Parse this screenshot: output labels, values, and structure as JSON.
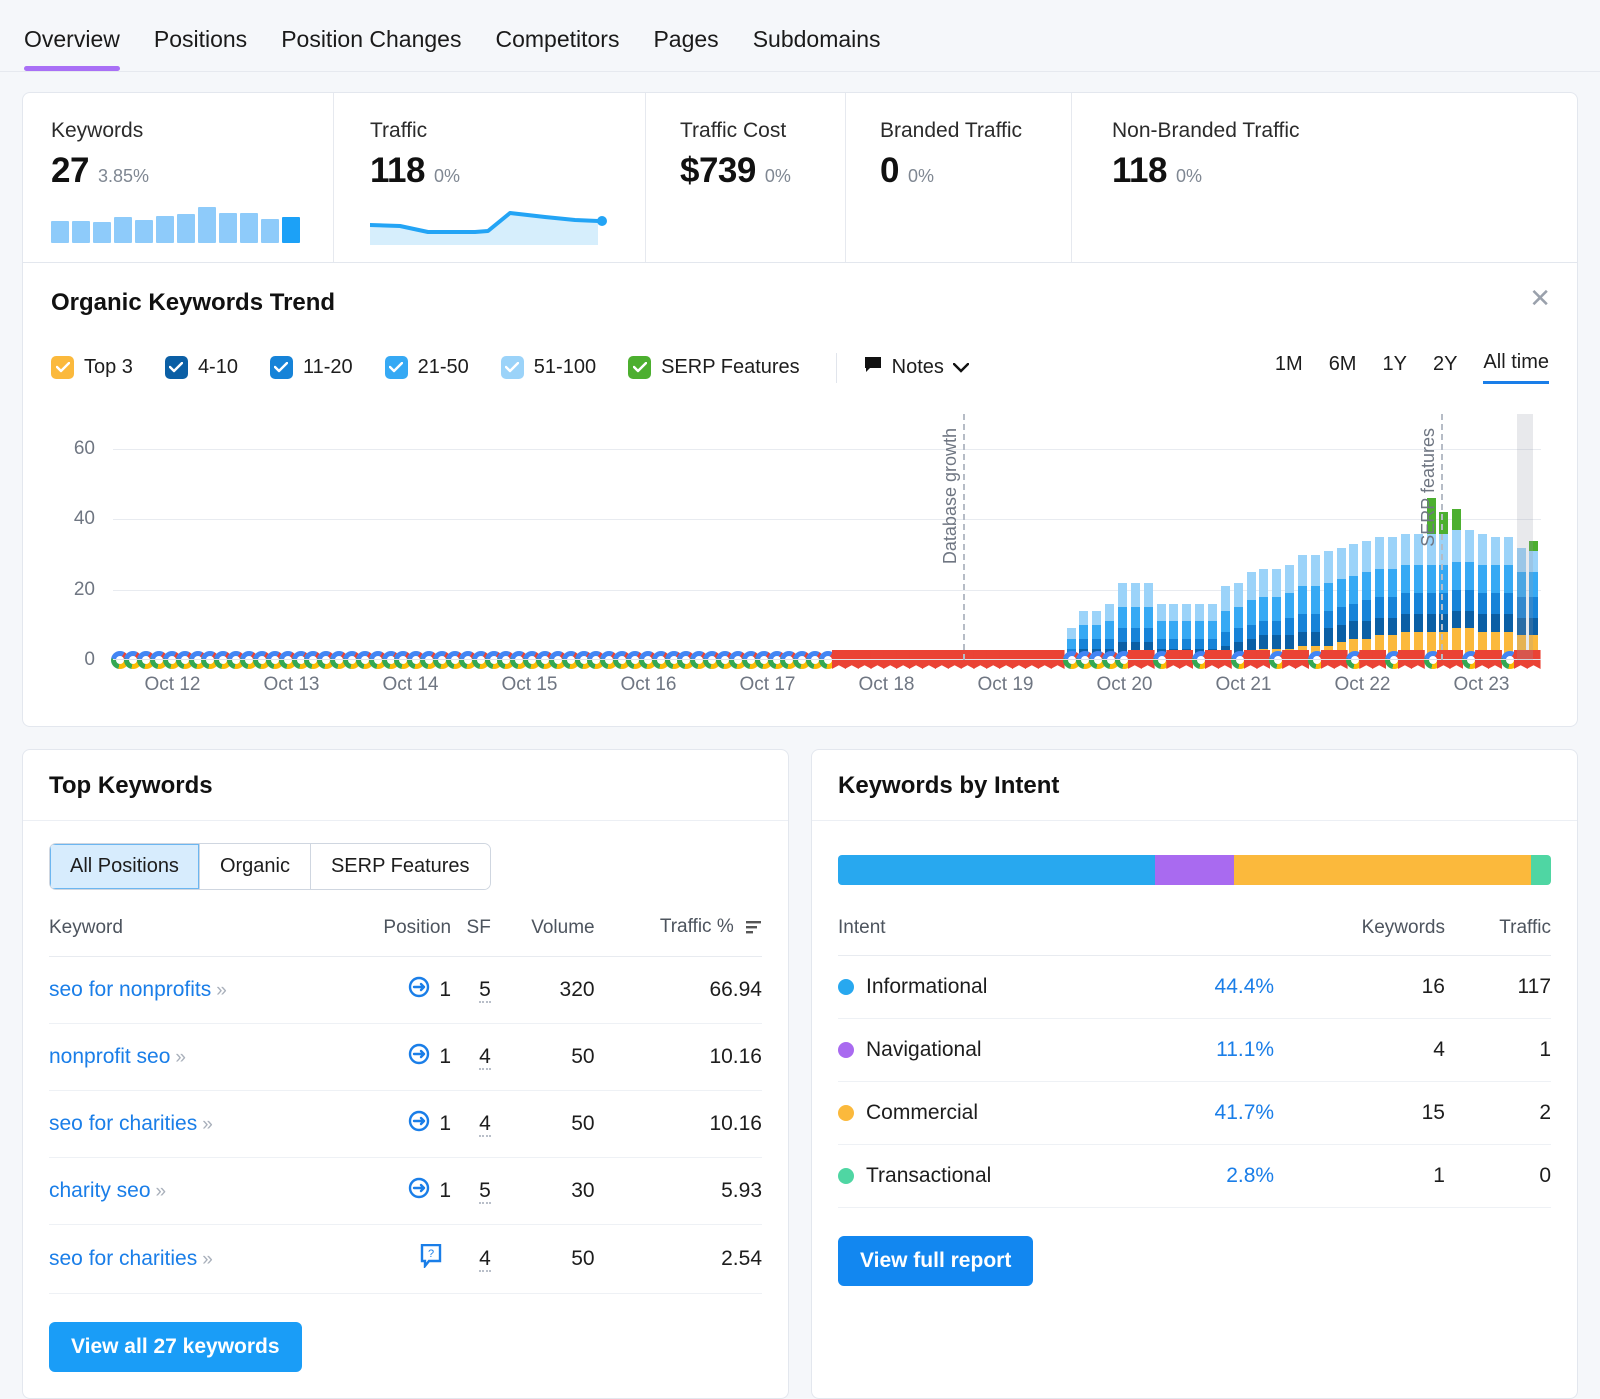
{
  "tabs": [
    {
      "label": "Overview",
      "active": true
    },
    {
      "label": "Positions",
      "active": false
    },
    {
      "label": "Position Changes",
      "active": false
    },
    {
      "label": "Competitors",
      "active": false
    },
    {
      "label": "Pages",
      "active": false
    },
    {
      "label": "Subdomains",
      "active": false
    }
  ],
  "metrics": [
    {
      "label": "Keywords",
      "value": "27",
      "delta": "3.85%"
    },
    {
      "label": "Traffic",
      "value": "118",
      "delta": "0%"
    },
    {
      "label": "Traffic Cost",
      "value": "$739",
      "delta": "0%"
    },
    {
      "label": "Branded Traffic",
      "value": "0",
      "delta": "0%"
    },
    {
      "label": "Non-Branded Traffic",
      "value": "118",
      "delta": "0%"
    }
  ],
  "keywords_sparkline": [
    22,
    22,
    21,
    26,
    23,
    27,
    29,
    36,
    30,
    30,
    24,
    26
  ],
  "trend": {
    "title": "Organic Keywords Trend",
    "close_label": "✕",
    "legend": [
      {
        "label": "Top 3",
        "color": "#fbb93c",
        "checked": true
      },
      {
        "label": "4-10",
        "color": "#0b5fa5",
        "checked": true
      },
      {
        "label": "11-20",
        "color": "#1683d8",
        "checked": true
      },
      {
        "label": "21-50",
        "color": "#36a9f4",
        "checked": true
      },
      {
        "label": "51-100",
        "color": "#9bd3f9",
        "checked": true
      },
      {
        "label": "SERP Features",
        "color": "#4caf2f",
        "checked": true
      }
    ],
    "notes_label": "Notes",
    "ranges": [
      {
        "label": "1M",
        "active": false
      },
      {
        "label": "6M",
        "active": false
      },
      {
        "label": "1Y",
        "active": false
      },
      {
        "label": "2Y",
        "active": false
      },
      {
        "label": "All time",
        "active": true
      }
    ]
  },
  "chart_data": {
    "type": "bar",
    "title": "Organic Keywords Trend",
    "xlabel": "",
    "ylabel": "",
    "ylim": [
      0,
      70
    ],
    "yticks": [
      0,
      20,
      40,
      60
    ],
    "grid": true,
    "legend_position": "top-left",
    "stacked": true,
    "x_tick_labels": [
      "Oct 12",
      "Oct 13",
      "Oct 14",
      "Oct 15",
      "Oct 16",
      "Oct 17",
      "Oct 18",
      "Oct 19",
      "Oct 20",
      "Oct 21",
      "Oct 22",
      "Oct 23"
    ],
    "annotations": [
      {
        "label": "Database growth",
        "x_position_pct": 59.5
      },
      {
        "label": "SERP features",
        "x_position_pct": 93.0
      }
    ],
    "series": [
      {
        "name": "Top 3",
        "color": "#fbb93c",
        "values": [
          0,
          0,
          0,
          0,
          0,
          0,
          0,
          0,
          0,
          0,
          0,
          0,
          0,
          0,
          0,
          0,
          0,
          0,
          0,
          0,
          0,
          0,
          0,
          0,
          0,
          0,
          0,
          0,
          0,
          0,
          0,
          0,
          0,
          0,
          0,
          0,
          0,
          0,
          0,
          0,
          0,
          0,
          0,
          0,
          0,
          0,
          0,
          0,
          0,
          0,
          0,
          0,
          0,
          0,
          0,
          0,
          0,
          0,
          0,
          0,
          0,
          0,
          0,
          0,
          0,
          0,
          0,
          0,
          0,
          0,
          0,
          0,
          0,
          0,
          0,
          1,
          1,
          1,
          2,
          2,
          2,
          1,
          1,
          1,
          1,
          1,
          1,
          2,
          2,
          3,
          3,
          3,
          4,
          4,
          4,
          5,
          6,
          6,
          7,
          7,
          8,
          8,
          8,
          8,
          9,
          9,
          8,
          8,
          8,
          7,
          7
        ]
      },
      {
        "name": "4-10",
        "color": "#0b5fa5",
        "values": [
          0,
          0,
          0,
          0,
          0,
          0,
          0,
          0,
          0,
          0,
          0,
          0,
          0,
          0,
          0,
          0,
          0,
          0,
          0,
          0,
          0,
          0,
          0,
          0,
          0,
          0,
          0,
          0,
          0,
          0,
          0,
          0,
          0,
          0,
          0,
          0,
          0,
          0,
          0,
          0,
          0,
          0,
          0,
          0,
          0,
          0,
          0,
          0,
          0,
          0,
          0,
          0,
          0,
          0,
          0,
          0,
          0,
          0,
          0,
          0,
          0,
          0,
          0,
          0,
          0,
          0,
          0,
          0,
          0,
          0,
          0,
          0,
          0,
          0,
          1,
          2,
          2,
          2,
          3,
          3,
          3,
          2,
          2,
          2,
          2,
          2,
          3,
          3,
          4,
          4,
          4,
          4,
          4,
          4,
          5,
          5,
          5,
          5,
          5,
          5,
          5,
          5,
          5,
          5,
          5,
          5,
          5,
          5,
          5,
          5,
          5
        ]
      },
      {
        "name": "11-20",
        "color": "#1683d8",
        "values": [
          0,
          0,
          0,
          0,
          0,
          0,
          0,
          0,
          0,
          0,
          0,
          0,
          0,
          0,
          0,
          0,
          0,
          0,
          0,
          0,
          0,
          0,
          0,
          0,
          0,
          0,
          0,
          0,
          0,
          0,
          0,
          0,
          0,
          0,
          0,
          0,
          0,
          0,
          0,
          0,
          0,
          0,
          0,
          0,
          0,
          0,
          0,
          0,
          0,
          0,
          0,
          0,
          0,
          0,
          0,
          0,
          0,
          0,
          0,
          0,
          0,
          0,
          0,
          0,
          0,
          0,
          0,
          0,
          0,
          0,
          0,
          0,
          0,
          0,
          2,
          3,
          3,
          3,
          4,
          4,
          4,
          3,
          3,
          3,
          3,
          3,
          4,
          4,
          4,
          4,
          4,
          5,
          5,
          5,
          5,
          5,
          5,
          6,
          6,
          6,
          6,
          6,
          6,
          6,
          6,
          6,
          6,
          6,
          6,
          6,
          6
        ]
      },
      {
        "name": "21-50",
        "color": "#36a9f4",
        "values": [
          0,
          0,
          0,
          0,
          0,
          0,
          0,
          0,
          0,
          0,
          0,
          0,
          0,
          0,
          0,
          0,
          0,
          0,
          0,
          0,
          0,
          0,
          0,
          0,
          0,
          0,
          0,
          0,
          0,
          0,
          0,
          0,
          0,
          0,
          0,
          0,
          0,
          0,
          0,
          0,
          0,
          0,
          0,
          0,
          0,
          0,
          0,
          0,
          0,
          0,
          0,
          0,
          0,
          0,
          0,
          0,
          0,
          0,
          0,
          0,
          0,
          0,
          0,
          0,
          0,
          0,
          0,
          0,
          0,
          0,
          0,
          0,
          0,
          0,
          3,
          4,
          4,
          5,
          6,
          6,
          6,
          5,
          5,
          5,
          5,
          5,
          6,
          6,
          7,
          7,
          7,
          7,
          8,
          8,
          8,
          8,
          8,
          8,
          8,
          8,
          8,
          8,
          8,
          8,
          8,
          8,
          8,
          8,
          8,
          7,
          7
        ]
      },
      {
        "name": "51-100",
        "color": "#9bd3f9",
        "values": [
          0,
          0,
          0,
          0,
          0,
          0,
          0,
          0,
          0,
          0,
          0,
          0,
          0,
          0,
          0,
          0,
          0,
          0,
          0,
          0,
          0,
          0,
          0,
          0,
          0,
          0,
          0,
          0,
          0,
          0,
          0,
          0,
          0,
          0,
          0,
          0,
          0,
          0,
          0,
          0,
          0,
          0,
          0,
          0,
          0,
          0,
          0,
          0,
          0,
          0,
          0,
          0,
          0,
          0,
          0,
          0,
          0,
          0,
          0,
          0,
          0,
          0,
          0,
          0,
          0,
          0,
          0,
          0,
          0,
          0,
          0,
          0,
          0,
          0,
          3,
          4,
          4,
          5,
          7,
          7,
          7,
          5,
          5,
          5,
          5,
          5,
          7,
          7,
          8,
          8,
          8,
          8,
          9,
          9,
          9,
          9,
          9,
          9,
          9,
          9,
          9,
          9,
          9,
          9,
          9,
          9,
          9,
          8,
          8,
          7,
          6
        ]
      },
      {
        "name": "SERP Features",
        "color": "#4caf2f",
        "values": [
          0,
          0,
          0,
          0,
          0,
          0,
          0,
          0,
          0,
          0,
          0,
          0,
          0,
          0,
          0,
          0,
          0,
          0,
          0,
          0,
          0,
          0,
          0,
          0,
          0,
          0,
          0,
          0,
          0,
          0,
          0,
          0,
          0,
          0,
          0,
          0,
          0,
          0,
          0,
          0,
          0,
          0,
          0,
          0,
          0,
          0,
          0,
          0,
          0,
          0,
          0,
          0,
          0,
          0,
          0,
          0,
          0,
          0,
          0,
          0,
          0,
          0,
          0,
          0,
          0,
          0,
          0,
          0,
          0,
          0,
          0,
          0,
          0,
          0,
          0,
          0,
          0,
          0,
          0,
          0,
          0,
          0,
          0,
          0,
          0,
          0,
          0,
          0,
          0,
          0,
          0,
          0,
          0,
          0,
          0,
          0,
          0,
          0,
          0,
          0,
          0,
          0,
          10,
          6,
          6,
          0,
          0,
          0,
          0,
          0,
          3
        ]
      }
    ]
  },
  "top_keywords": {
    "title": "Top Keywords",
    "tabs": [
      {
        "label": "All Positions",
        "active": true
      },
      {
        "label": "Organic",
        "active": false
      },
      {
        "label": "SERP Features",
        "active": false
      }
    ],
    "columns": [
      "Keyword",
      "Position",
      "SF",
      "Volume",
      "Traffic %"
    ],
    "rows": [
      {
        "keyword": "seo for nonprofits",
        "icon": "link-icon",
        "position": "1",
        "sf": "5",
        "volume": "320",
        "traffic_pct": "66.94"
      },
      {
        "keyword": "nonprofit seo",
        "icon": "link-icon",
        "position": "1",
        "sf": "4",
        "volume": "50",
        "traffic_pct": "10.16"
      },
      {
        "keyword": "seo for charities",
        "icon": "link-icon",
        "position": "1",
        "sf": "4",
        "volume": "50",
        "traffic_pct": "10.16"
      },
      {
        "keyword": "charity seo",
        "icon": "link-icon",
        "position": "1",
        "sf": "5",
        "volume": "30",
        "traffic_pct": "5.93"
      },
      {
        "keyword": "seo for charities",
        "icon": "faq-icon",
        "position": "",
        "sf": "4",
        "volume": "50",
        "traffic_pct": "2.54"
      }
    ],
    "view_all_label": "View all 27 keywords"
  },
  "keywords_by_intent": {
    "title": "Keywords by Intent",
    "bar": [
      {
        "name": "Informational",
        "pct": 44.4,
        "color": "#28a8ef"
      },
      {
        "name": "Navigational",
        "pct": 11.1,
        "color": "#a96af0"
      },
      {
        "name": "Commercial",
        "pct": 41.7,
        "color": "#fbb93c"
      },
      {
        "name": "Transactional",
        "pct": 2.8,
        "color": "#4fd6a3"
      }
    ],
    "columns": [
      "Intent",
      "",
      "Keywords",
      "Traffic"
    ],
    "rows": [
      {
        "intent": "Informational",
        "color": "#28a8ef",
        "pct": "44.4%",
        "keywords": "16",
        "traffic": "117"
      },
      {
        "intent": "Navigational",
        "color": "#a96af0",
        "pct": "11.1%",
        "keywords": "4",
        "traffic": "1"
      },
      {
        "intent": "Commercial",
        "color": "#fbb93c",
        "pct": "41.7%",
        "keywords": "15",
        "traffic": "2"
      },
      {
        "intent": "Transactional",
        "color": "#4fd6a3",
        "pct": "2.8%",
        "keywords": "1",
        "traffic": "0"
      }
    ],
    "view_report_label": "View full report"
  }
}
